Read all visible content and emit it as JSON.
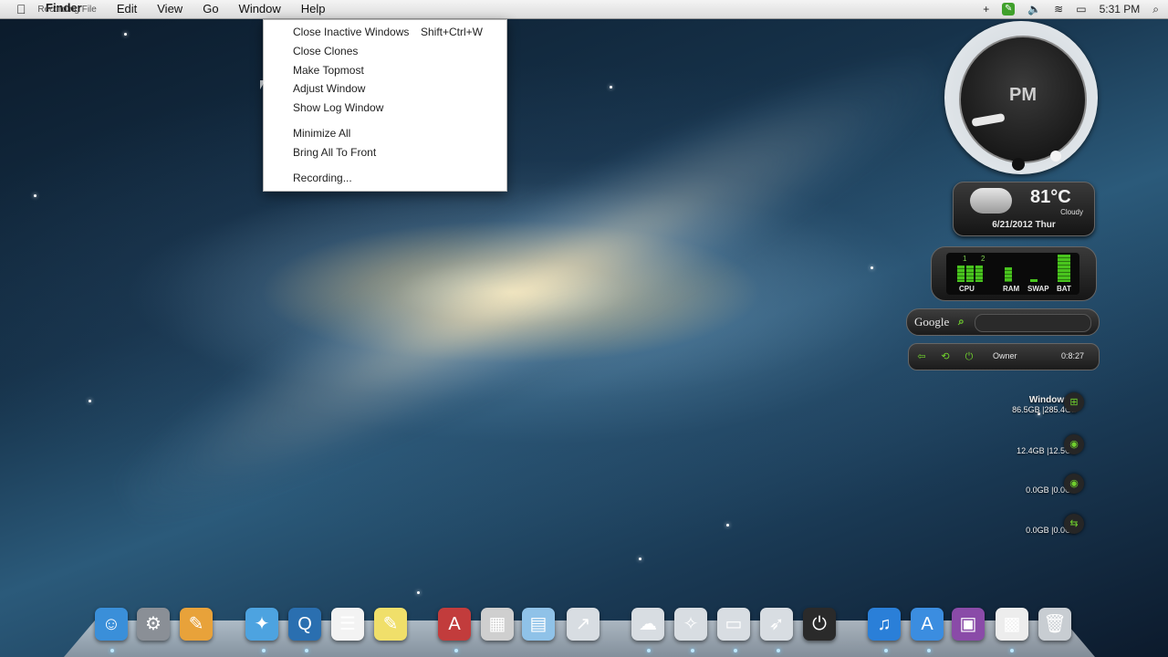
{
  "menubar": {
    "app_name": "Finder",
    "overlay_text": "Recording File",
    "items": [
      "Edit",
      "View",
      "Go",
      "Window",
      "Help"
    ],
    "clock": "5:31 PM",
    "icons": [
      "plus-icon",
      "app-icon",
      "volume-icon",
      "wifi-icon",
      "battery-icon",
      "search-icon"
    ]
  },
  "window_menu": {
    "items": [
      {
        "label": "Close Inactive Windows",
        "shortcut": "Shift+Ctrl+W"
      },
      {
        "label": "Close Clones",
        "shortcut": ""
      },
      {
        "label": "Make Topmost",
        "shortcut": ""
      },
      {
        "label": "Adjust Window",
        "shortcut": ""
      },
      {
        "label": "Show Log Window",
        "shortcut": ""
      },
      {
        "label": "Minimize All",
        "shortcut": ""
      },
      {
        "label": "Bring All To Front",
        "shortcut": ""
      },
      {
        "label": "Recording...",
        "shortcut": ""
      }
    ]
  },
  "widgets": {
    "clock": {
      "meridiem": "PM"
    },
    "weather": {
      "temp": "81°C",
      "condition": "Cloudy",
      "date": "6/21/2012 Thur"
    },
    "meter": {
      "labels": [
        "CPU",
        "RAM",
        "SWAP",
        "BAT"
      ],
      "markers": [
        "1",
        "2"
      ]
    },
    "google": {
      "label": "Google"
    },
    "user": {
      "name": "Owner",
      "uptime": "0:8:27"
    },
    "drives": [
      {
        "title": "Windows 7",
        "usage": "86.5GB |285.4GB"
      },
      {
        "title": "",
        "usage": "12.4GB |12.5GB"
      },
      {
        "title": "",
        "usage": "0.0GB |0.0GB"
      },
      {
        "title": "",
        "usage": "0.0GB |0.0GB"
      }
    ]
  },
  "dock": {
    "icons": [
      {
        "name": "finder-icon",
        "color": "#3a8fd9",
        "glyph": "☺"
      },
      {
        "name": "system-preferences-icon",
        "color": "#8a8f96",
        "glyph": "⚙"
      },
      {
        "name": "dashboard-icon",
        "color": "#e8a23a",
        "glyph": "✎"
      },
      {
        "name": "safari-icon",
        "color": "#4da3e0",
        "glyph": "✦"
      },
      {
        "name": "quicktime-icon",
        "color": "#2a6fb0",
        "glyph": "Q"
      },
      {
        "name": "text-edit-icon",
        "color": "#f3f3f3",
        "glyph": "☰"
      },
      {
        "name": "stickies-icon",
        "color": "#f0df6a",
        "glyph": "✎"
      },
      {
        "name": "app-store-icon",
        "color": "#c23c3c",
        "glyph": "A"
      },
      {
        "name": "utilities-icon",
        "color": "#cfcfcf",
        "glyph": "▦"
      },
      {
        "name": "applications-folder-icon",
        "color": "#8fc2e8",
        "glyph": "▤"
      },
      {
        "name": "share-icon",
        "color": "#d8dde2",
        "glyph": "↗"
      },
      {
        "name": "icloud-icon",
        "color": "#d8dde2",
        "glyph": "☁"
      },
      {
        "name": "twitter-icon",
        "color": "#d8dde2",
        "glyph": "✧"
      },
      {
        "name": "airplay-icon",
        "color": "#d8dde2",
        "glyph": "▭"
      },
      {
        "name": "launchpad-icon",
        "color": "#d8dde2",
        "glyph": "➶"
      },
      {
        "name": "power-icon",
        "color": "#2a2a2a",
        "glyph": "⏻"
      },
      {
        "name": "itunes-icon",
        "color": "#2a7fd8",
        "glyph": "♫"
      },
      {
        "name": "app-store-blue-icon",
        "color": "#3b8de0",
        "glyph": "A"
      },
      {
        "name": "mission-control-icon",
        "color": "#8a4ba8",
        "glyph": "▣"
      },
      {
        "name": "qr-code-icon",
        "color": "#ededed",
        "glyph": "▩"
      },
      {
        "name": "trash-icon",
        "color": "#c8cdd2",
        "glyph": "🗑"
      }
    ]
  }
}
